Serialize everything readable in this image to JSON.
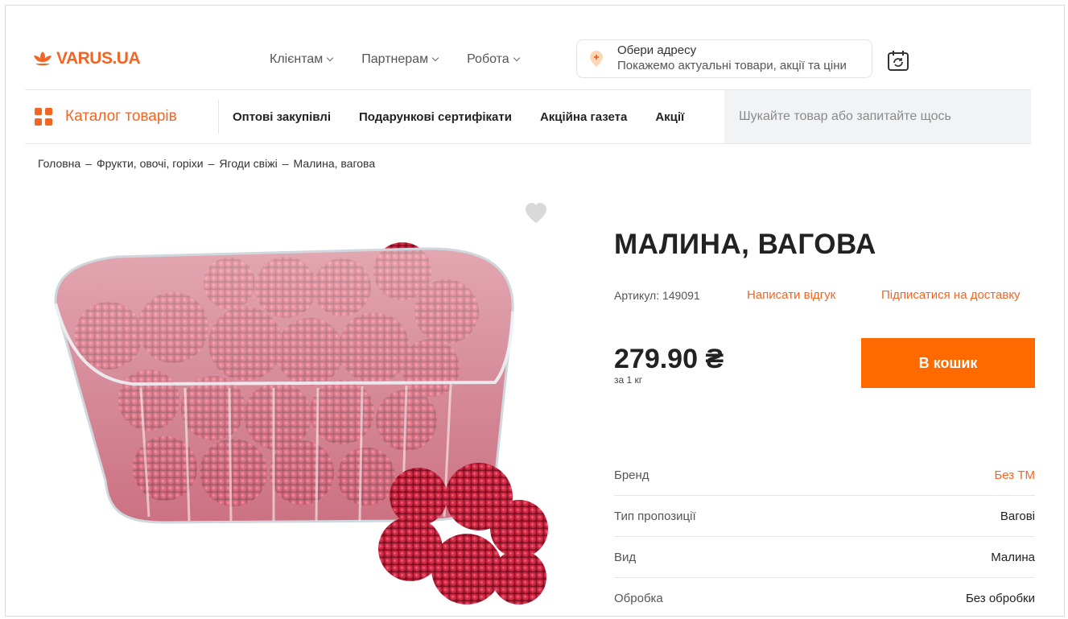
{
  "header": {
    "logo_text": "VARUS.UA",
    "nav": [
      {
        "label": "Клієнтам"
      },
      {
        "label": "Партнерам"
      },
      {
        "label": "Робота"
      }
    ],
    "address": {
      "title": "Обери адресу",
      "subtitle": "Покажемо актуальні товари, акції та ціни"
    },
    "brand_color": "#f26522"
  },
  "navbar": {
    "catalog_label": "Каталог товарів",
    "links": [
      "Оптові закупівлі",
      "Подарункові сертифікати",
      "Акційна газета",
      "Акції"
    ],
    "search_placeholder": "Шукайте товар або запитайте щось"
  },
  "breadcrumb": [
    "Головна",
    "Фрукти, овочі, горіхи",
    "Ягоди свіжі",
    "Малина, вагова"
  ],
  "breadcrumb_separator": "–",
  "product": {
    "title": "МАЛИНА, ВАГОВА",
    "sku": "Артикул: 149091",
    "review_link": "Написати відгук",
    "subscribe_link": "Підписатися на доставку",
    "price": "279.90 ₴",
    "unit": "за 1 кг",
    "cart_button": "В кошик",
    "button_color": "#ff6a00",
    "specs": [
      {
        "key": "Бренд",
        "value": "Без ТМ"
      },
      {
        "key": "Тип пропозиції",
        "value": "Вагові"
      },
      {
        "key": "Вид",
        "value": "Малина"
      },
      {
        "key": "Обробка",
        "value": "Без обробки"
      }
    ]
  }
}
